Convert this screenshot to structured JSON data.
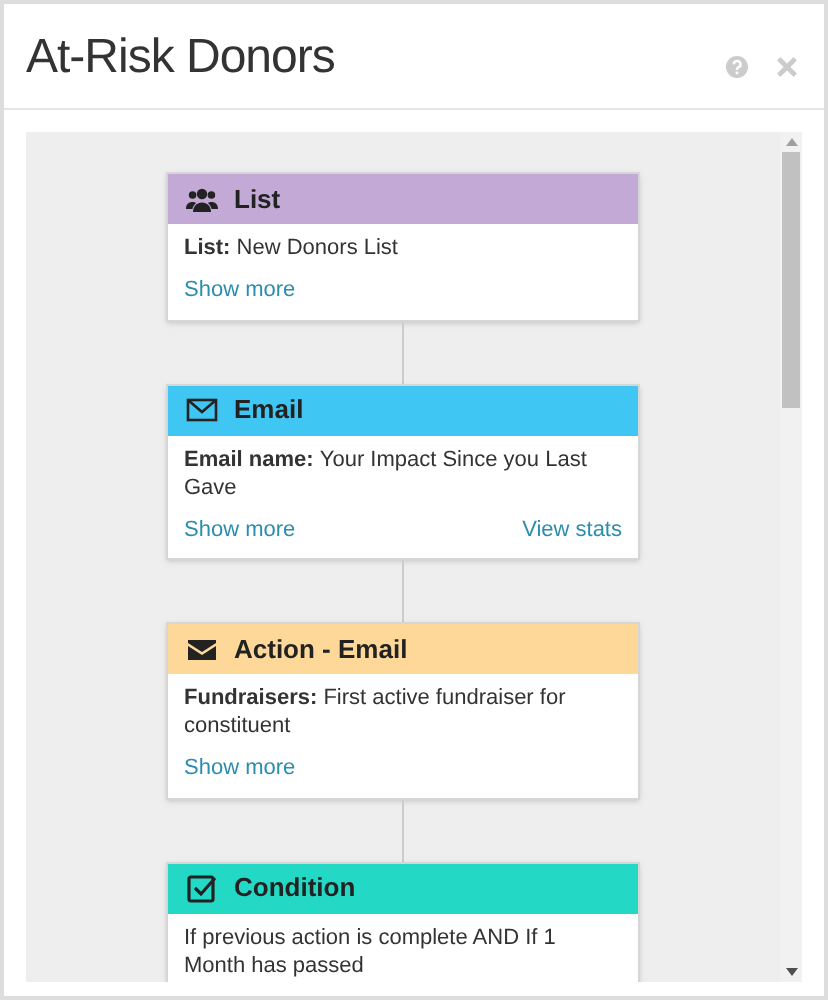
{
  "window": {
    "title": "At-Risk Donors"
  },
  "steps": [
    {
      "kind": "list",
      "title": "List",
      "color": "#c2a9d6",
      "label": "List:",
      "value": "New Donors List",
      "links": [
        "Show more"
      ]
    },
    {
      "kind": "email",
      "title": "Email",
      "color": "#3fc6f2",
      "label": "Email name:",
      "value": "Your Impact Since you Last Gave",
      "links": [
        "Show more",
        "View stats"
      ]
    },
    {
      "kind": "action",
      "title": "Action - Email",
      "color": "#fdd898",
      "label": "Fundraisers:",
      "value": "First active fundraiser for constituent",
      "links": [
        "Show more"
      ]
    },
    {
      "kind": "condition",
      "title": "Condition",
      "color": "#24d8c6",
      "value": "If previous action is complete AND If 1 Month has passed"
    }
  ]
}
